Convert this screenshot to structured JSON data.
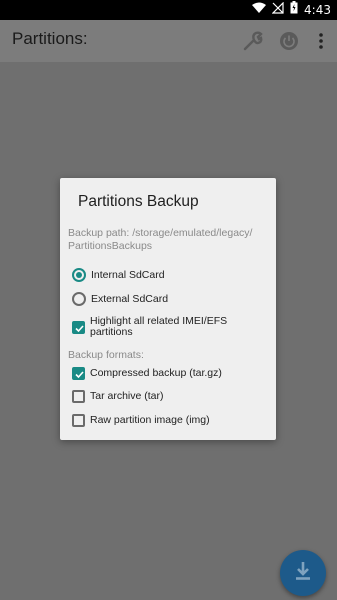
{
  "status_bar": {
    "time": "4:43",
    "icons": [
      "wifi-icon",
      "signal-off-icon",
      "battery-charging-icon"
    ]
  },
  "toolbar": {
    "title": "Partitions:",
    "actions": [
      "wrench-icon",
      "power-icon",
      "more-vert-icon"
    ]
  },
  "dialog": {
    "title": "Partitions Backup",
    "backup_path_label": "Backup path: /storage/emulated/legacy/ PartitionsBackups",
    "storage_options": [
      {
        "label": "Internal SdCard",
        "checked": true
      },
      {
        "label": "External SdCard",
        "checked": false
      }
    ],
    "highlight_option": {
      "label": "Highlight all related IMEI/EFS partitions",
      "checked": true
    },
    "formats_label": "Backup formats:",
    "formats": [
      {
        "label": "Compressed backup (tar.gz)",
        "checked": true
      },
      {
        "label": "Tar archive (tar)",
        "checked": false
      },
      {
        "label": "Raw partition image (img)",
        "checked": false
      }
    ]
  },
  "fab": {
    "icon": "download-icon"
  },
  "colors": {
    "accent": "#198a85",
    "fab": "#1d5a8a",
    "scrim": "#6f6f6f",
    "dialog_bg": "#efefef"
  }
}
